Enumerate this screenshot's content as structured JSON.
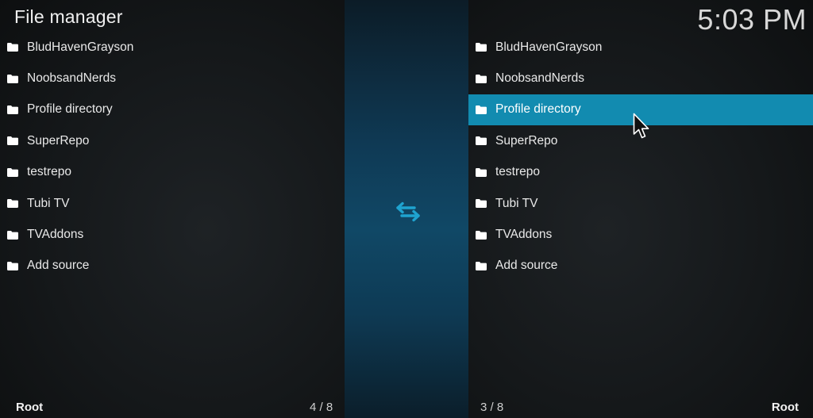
{
  "header": {
    "title": "File manager",
    "clock": "5:03 PM"
  },
  "left_pane": {
    "items": [
      {
        "label": "BludHavenGrayson"
      },
      {
        "label": "NoobsandNerds"
      },
      {
        "label": "Profile directory"
      },
      {
        "label": "SuperRepo"
      },
      {
        "label": "testrepo"
      },
      {
        "label": "Tubi TV"
      },
      {
        "label": "TVAddons"
      },
      {
        "label": "Add source"
      }
    ],
    "footer_path": "Root",
    "footer_count": "4 / 8"
  },
  "right_pane": {
    "items": [
      {
        "label": "BludHavenGrayson"
      },
      {
        "label": "NoobsandNerds"
      },
      {
        "label": "Profile directory",
        "selected": true
      },
      {
        "label": "SuperRepo"
      },
      {
        "label": "testrepo"
      },
      {
        "label": "Tubi TV"
      },
      {
        "label": "TVAddons"
      },
      {
        "label": "Add source"
      }
    ],
    "footer_path": "Root",
    "footer_count": "3 / 8"
  },
  "icons": {
    "folder": "folder-icon",
    "swap": "swap-arrows-icon",
    "cursor": "mouse-pointer-icon"
  },
  "colors": {
    "accent": "#128bb0",
    "swap_arrows": "#1fa3cf"
  }
}
